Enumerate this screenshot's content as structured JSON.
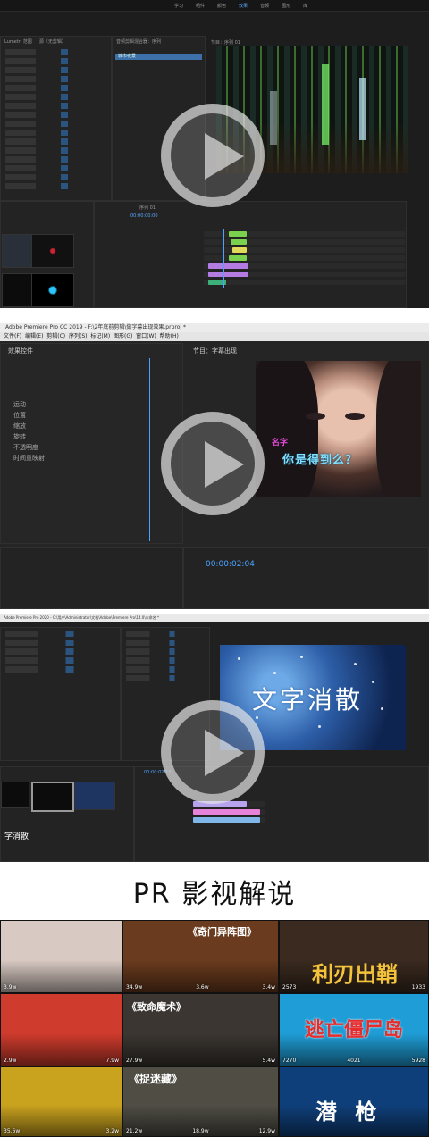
{
  "panel1": {
    "top_menu": [
      "学习",
      "组件",
      "颜色",
      "效果",
      "音频",
      "图形",
      "库"
    ],
    "tabs": [
      "Lumetri 范围",
      "源（无剪辑）",
      "效果控件",
      "音频剪辑混合器：序列"
    ],
    "program_label": "节目：序列 01",
    "timecode": "00:00:00:00",
    "sequence_name": "序列 01",
    "clip_label": "城市夜景"
  },
  "panel2": {
    "window_title": "Adobe Premiere Pro CC 2019 - F:\\2年底前剪辑\\做字幕出现效果.prproj *",
    "menu": [
      "文件(F)",
      "编辑(E)",
      "剪辑(C)",
      "序列(S)",
      "标记(M)",
      "图形(G)",
      "窗口(W)",
      "帮助(H)"
    ],
    "effect_controls_tab": "效果控件",
    "program_tab": "节目：字幕出现",
    "subtitle_name": "名字",
    "subtitle_line": "你是得到么？",
    "timecode": "00:00:02:04",
    "properties": [
      "运动",
      "位置",
      "缩放",
      "旋转",
      "不透明度",
      "时间重映射"
    ]
  },
  "panel3": {
    "window_title": "Adobe Premiere Pro 2020 - C:\\用户\\Administrator\\文档\\Adobe\\Premiere Pro\\14.0\\未命名 *",
    "overlay_text": "文字消散",
    "bin_label": "字消散",
    "timecode": "00:00:02:11"
  },
  "caption": "PR 影视解说",
  "posters": [
    {
      "title": "",
      "s1": "3.9w",
      "s2": "",
      "s3": "",
      "bg": "#d8c9c2"
    },
    {
      "title": "《奇门异阵图》",
      "s1": "34.9w",
      "s2": "3.6w",
      "s3": "3.4w",
      "bg": "#6a3b1e"
    },
    {
      "title": "利刃出鞘",
      "s1": "2573",
      "s2": "1933",
      "s3": "",
      "bg": "#3a2a1f"
    },
    {
      "title": "",
      "s1": "2.9w",
      "s2": "7.9w",
      "s3": "",
      "bg": "#cf3b2c"
    },
    {
      "title": "《致命魔术》",
      "s1": "27.9w",
      "s2": "5.4w",
      "s3": "",
      "bg": "#3b3631"
    },
    {
      "title": "逃亡僵尸岛",
      "s1": "7270",
      "s2": "4021",
      "s3": "5928",
      "bg": "#1f9dd6"
    },
    {
      "title": "",
      "s1": "35.6w",
      "s2": "3.2w",
      "s3": "",
      "bg": "#c9a21e"
    },
    {
      "title": "《捉迷藏》",
      "s1": "21.2w",
      "s2": "18.9w",
      "s3": "12.9w",
      "bg": "#4f4d44"
    },
    {
      "title": "潜 枪",
      "s1": "",
      "s2": "",
      "s3": "",
      "bg": "#0f3f7a"
    }
  ]
}
